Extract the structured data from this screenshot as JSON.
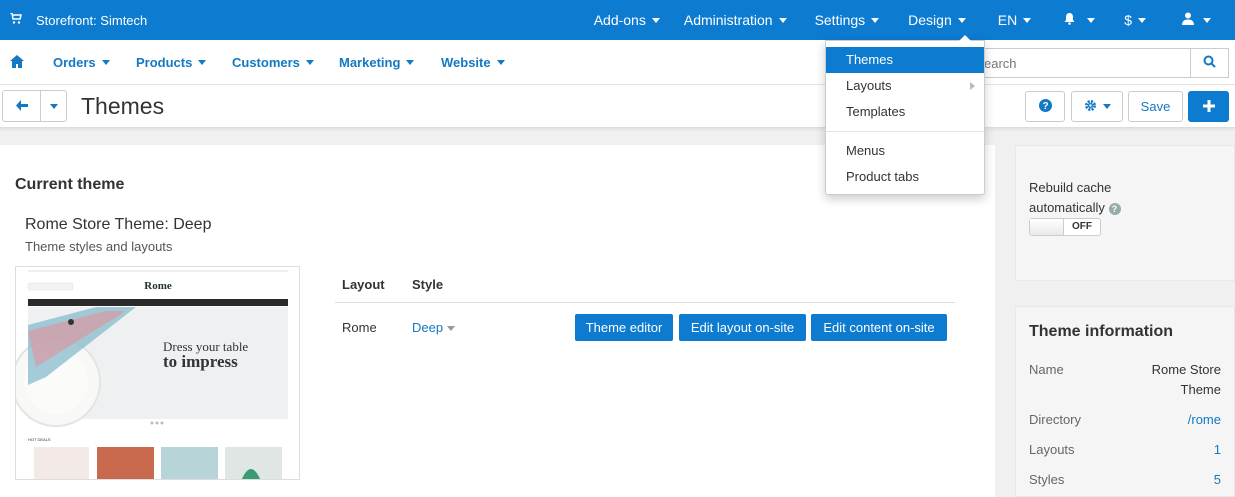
{
  "topbar": {
    "store_label": "Storefront: Simtech",
    "nav": [
      "Add-ons",
      "Administration",
      "Settings",
      "Design",
      "EN",
      "$"
    ]
  },
  "secnav": {
    "items": [
      "Orders",
      "Products",
      "Customers",
      "Marketing",
      "Website"
    ],
    "search_placeholder": "earch"
  },
  "titlebar": {
    "title": "Themes",
    "save_label": "Save"
  },
  "design_menu": {
    "items": [
      "Themes",
      "Layouts",
      "Templates",
      "Menus",
      "Product tabs"
    ],
    "active": "Themes"
  },
  "main": {
    "section_title": "Current theme",
    "theme_name": "Rome Store Theme: Deep",
    "theme_subtitle": "Theme styles and layouts",
    "table": {
      "headers": [
        "Layout",
        "Style"
      ],
      "row": {
        "layout": "Rome",
        "style": "Deep"
      },
      "buttons": [
        "Theme editor",
        "Edit layout on-site",
        "Edit content on-site"
      ]
    },
    "preview": {
      "brand": "Rome",
      "headline1": "Dress your table",
      "headline2": "to impress",
      "section": "HOT DEALS"
    }
  },
  "sidebar": {
    "rebuild_label_1": "Rebuild cache",
    "rebuild_label_2": "automatically",
    "toggle_state": "OFF",
    "info_title": "Theme information",
    "info": {
      "name_label": "Name",
      "name_value_1": "Rome Store",
      "name_value_2": "Theme",
      "directory_label": "Directory",
      "directory_value": "/rome",
      "layouts_label": "Layouts",
      "layouts_value": "1",
      "styles_label": "Styles",
      "styles_value": "5"
    }
  },
  "colors": {
    "primary": "#0c7bd0",
    "link": "#1379c2"
  }
}
